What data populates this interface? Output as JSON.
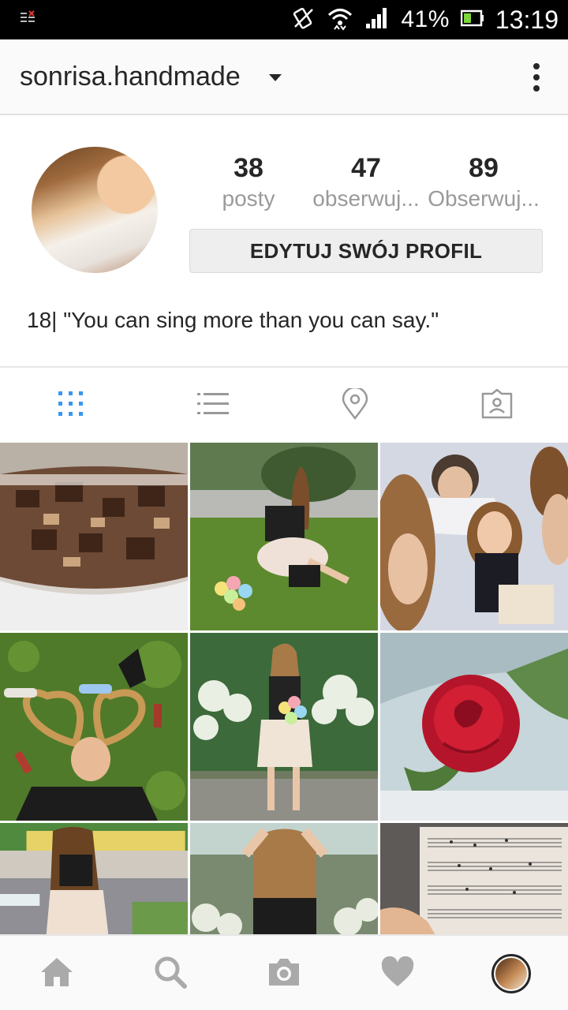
{
  "status_bar": {
    "battery_percent": "41%",
    "time": "13:19"
  },
  "header": {
    "username": "sonrisa.handmade"
  },
  "profile": {
    "stats": [
      {
        "value": "38",
        "label": "posty"
      },
      {
        "value": "47",
        "label": "obserwuj..."
      },
      {
        "value": "89",
        "label": "Obserwuj..."
      }
    ],
    "edit_button": "EDYTUJ SWÓJ PROFIL",
    "bio": "18| \"You can sing more than you can say.\""
  },
  "tabs": [
    {
      "icon": "grid-icon",
      "active": true
    },
    {
      "icon": "list-icon",
      "active": false
    },
    {
      "icon": "location-pin-icon",
      "active": false
    },
    {
      "icon": "tagged-photos-icon",
      "active": false
    }
  ],
  "grid_photos": [
    "chocolate-pieces-in-container",
    "girl-sitting-on-grass-with-balloons",
    "friends-selfie",
    "girl-lying-on-grass-heart-hair",
    "girl-standing-with-balloons",
    "red-rose",
    "girl-from-behind-long-hair",
    "girl-hands-on-head",
    "sheet-music"
  ],
  "bottom_nav": [
    {
      "icon": "home-icon"
    },
    {
      "icon": "search-icon"
    },
    {
      "icon": "camera-icon"
    },
    {
      "icon": "heart-icon"
    },
    {
      "icon": "profile-avatar-icon"
    }
  ],
  "colors": {
    "accent_blue": "#3897f0",
    "icon_gray": "#999999",
    "text_dark": "#262626",
    "text_muted": "#9a9a9a"
  }
}
